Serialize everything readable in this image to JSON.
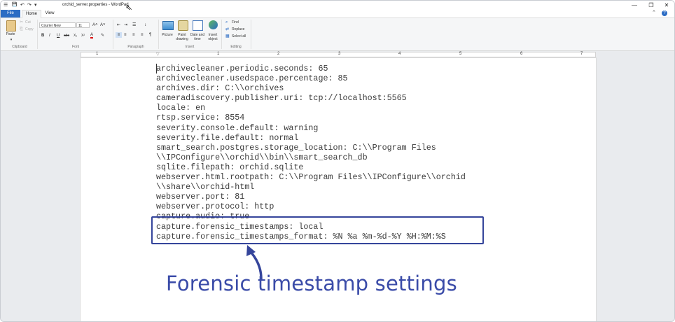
{
  "window": {
    "title": "orchid_server.properties - WordPad",
    "minimize_glyph": "—",
    "restore_glyph": "❐",
    "close_glyph": "✕",
    "collapse_glyph": "⌃",
    "help_glyph": "?"
  },
  "quick_access": {
    "app_glyph": "☰",
    "save_glyph": "💾",
    "undo_glyph": "↶",
    "redo_glyph": "↷",
    "dropdown_glyph": "▾"
  },
  "tabs": {
    "file": "File",
    "home": "Home",
    "view": "View"
  },
  "ribbon": {
    "clipboard": {
      "label": "Clipboard",
      "paste": "Paste",
      "cut": "Cut",
      "copy": "Copy"
    },
    "font": {
      "label": "Font",
      "family": "Courier New",
      "size": "11",
      "bold": "B",
      "italic": "I",
      "underline": "U",
      "strike": "abc",
      "subscript": "X₂",
      "superscript": "X²",
      "grow": "A˄",
      "shrink": "A˅",
      "color": "A"
    },
    "paragraph": {
      "label": "Paragraph"
    },
    "insert": {
      "label": "Insert",
      "picture": "Picture",
      "paint": "Paint drawing",
      "datetime": "Date and time",
      "object": "Insert object"
    },
    "editing": {
      "label": "Editing",
      "find": "Find",
      "replace": "Replace",
      "select_all": "Select all"
    }
  },
  "ruler": {
    "numbers": [
      "1",
      "1",
      "2",
      "3",
      "4",
      "5",
      "6",
      "7"
    ]
  },
  "document": {
    "lines": [
      "archivecleaner.periodic.seconds: 65",
      "archivecleaner.usedspace.percentage: 85",
      "archives.dir: C:\\\\orchives",
      "cameradiscovery.publisher.uri: tcp://localhost:5565",
      "locale: en",
      "rtsp.service: 8554",
      "severity.console.default: warning",
      "severity.file.default: normal",
      "smart_search.postgres.storage_location: C:\\\\Program Files",
      "\\\\IPConfigure\\\\orchid\\\\bin\\\\smart_search_db",
      "sqlite.filepath: orchid.sqlite",
      "webserver.html.rootpath: C:\\\\Program Files\\\\IPConfigure\\\\orchid",
      "\\\\share\\\\orchid-html",
      "webserver.port: 81",
      "webserver.protocol: http",
      "capture.audio: true",
      "capture.forensic_timestamps: local",
      "capture.forensic_timestamps_format: %N %a %m-%d-%Y %H:%M:%S"
    ]
  },
  "annotation": {
    "caption": "Forensic timestamp settings",
    "color": "#35459b"
  }
}
